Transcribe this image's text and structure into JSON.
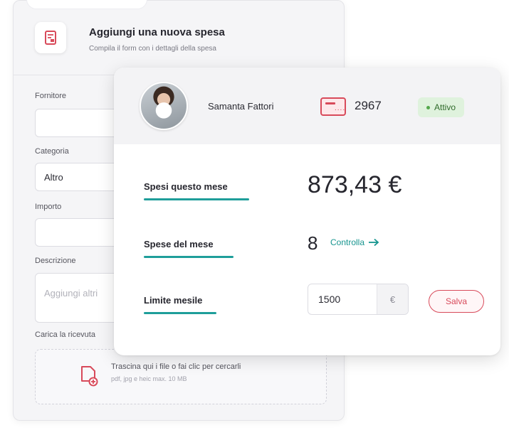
{
  "form": {
    "title": "Aggiungi una nuova spesa",
    "subtitle": "Compila il form con i dettagli della spesa",
    "fields": {
      "supplier_label": "Fornitore",
      "category_label": "Categoria",
      "category_value": "Altro",
      "amount_label": "Importo",
      "description_label": "Descrizione",
      "description_placeholder": "Aggiungi altri",
      "receipt_label": "Carica la ricevuta"
    },
    "upload": {
      "text": "Trascina qui i file o fai clic per cercarli",
      "hint": "pdf, jpg e heic max. 10 MB"
    }
  },
  "card": {
    "user_name": "Samanta Fattori",
    "card_number": "2967",
    "status": "Attivo",
    "spent_label": "Spesi questo mese",
    "spent_value": "873,43 €",
    "expenses_label": "Spese del mese",
    "expenses_count": "8",
    "check_link": "Controlla",
    "limit_label": "Limite mesile",
    "limit_value": "1500",
    "limit_currency": "€",
    "save_label": "Salva"
  },
  "colors": {
    "accent_teal": "#1e9e9a",
    "accent_red": "#d84a5a",
    "status_green_bg": "#dff2dd"
  }
}
